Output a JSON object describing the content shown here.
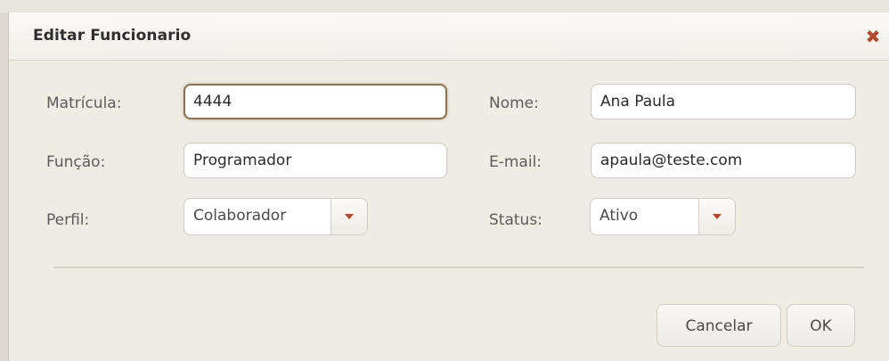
{
  "dialog": {
    "title": "Editar Funcionario",
    "close_icon": "close-x-icon"
  },
  "form": {
    "matricula": {
      "label": "Matrícula:",
      "value": "4444"
    },
    "nome": {
      "label": "Nome:",
      "value": "Ana Paula"
    },
    "funcao": {
      "label": "Função:",
      "value": "Programador"
    },
    "email": {
      "label": "E-mail:",
      "value": "apaula@teste.com"
    },
    "perfil": {
      "label": "Perfil:",
      "selected": "Colaborador"
    },
    "status": {
      "label": "Status:",
      "selected": "Ativo"
    }
  },
  "actions": {
    "cancel_label": "Cancelar",
    "ok_label": "OK"
  },
  "colors": {
    "accent": "#b2482c",
    "focus_border": "#8a7456",
    "background": "#efece4"
  }
}
